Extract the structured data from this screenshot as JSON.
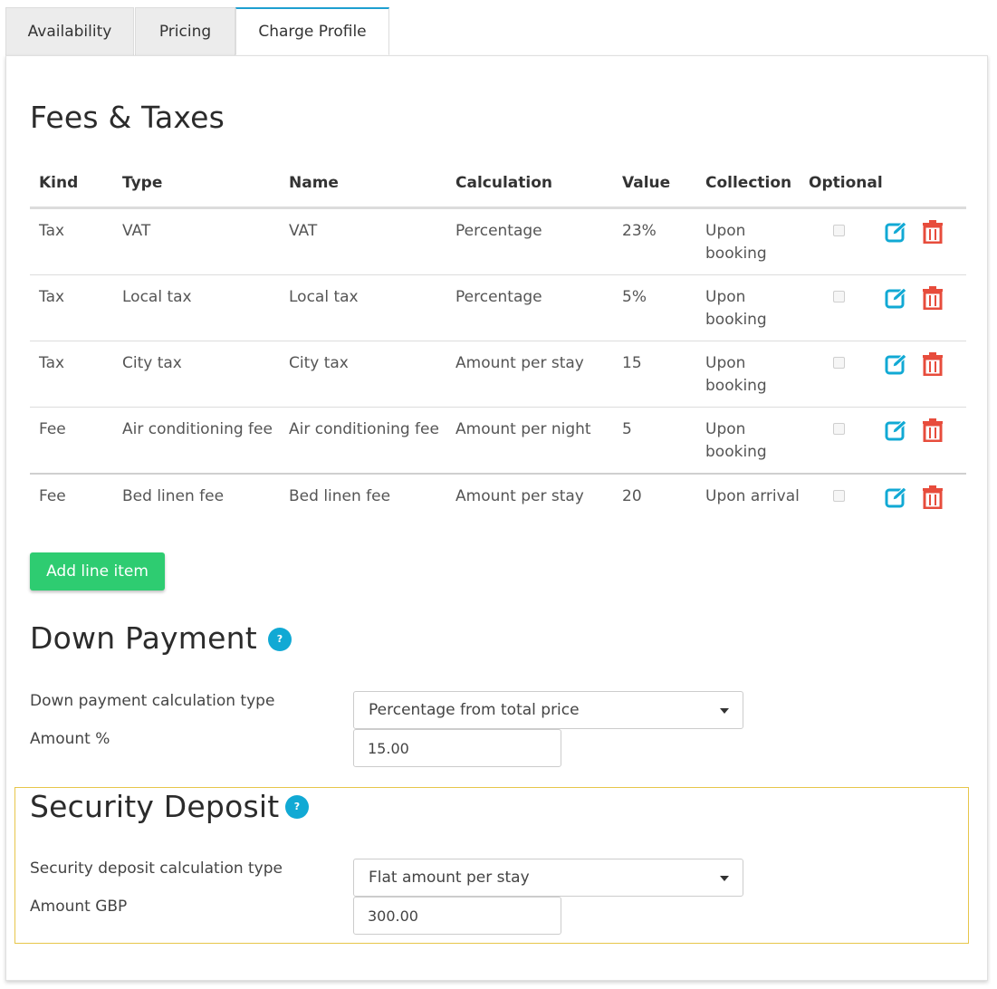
{
  "tabs": [
    {
      "label": "Availability",
      "active": false
    },
    {
      "label": "Pricing",
      "active": false
    },
    {
      "label": "Charge Profile",
      "active": true
    }
  ],
  "fees_taxes": {
    "title": "Fees & Taxes",
    "columns": [
      "Kind",
      "Type",
      "Name",
      "Calculation",
      "Value",
      "Collection",
      "Optional"
    ],
    "rows": [
      {
        "kind": "Tax",
        "type": "VAT",
        "name": "VAT",
        "calculation": "Percentage",
        "value": "23%",
        "collection": "Upon booking",
        "optional": false
      },
      {
        "kind": "Tax",
        "type": "Local tax",
        "name": "Local tax",
        "calculation": "Percentage",
        "value": "5%",
        "collection": "Upon booking",
        "optional": false
      },
      {
        "kind": "Tax",
        "type": "City tax",
        "name": "City tax",
        "calculation": "Amount per stay",
        "value": "15",
        "collection": "Upon booking",
        "optional": false
      },
      {
        "kind": "Fee",
        "type": "Air conditioning fee",
        "name": "Air conditioning fee",
        "calculation": "Amount per night",
        "value": "5",
        "collection": "Upon booking",
        "optional": false
      },
      {
        "kind": "Fee",
        "type": "Bed linen fee",
        "name": "Bed linen fee",
        "calculation": "Amount per stay",
        "value": "20",
        "collection": "Upon arrival",
        "optional": false
      }
    ],
    "add_button": "Add line item"
  },
  "down_payment": {
    "title": "Down Payment",
    "help": "?",
    "calc_type_label": "Down payment calculation type",
    "calc_type_value": "Percentage from total price",
    "amount_label": "Amount %",
    "amount_value": "15.00"
  },
  "security_deposit": {
    "title": "Security Deposit",
    "help": "?",
    "calc_type_label": "Security deposit calculation type",
    "calc_type_value": "Flat amount per stay",
    "amount_label": "Amount GBP",
    "amount_value": "300.00"
  },
  "colors": {
    "accent": "#1e9fd0",
    "edit_icon": "#11a9d4",
    "delete_icon": "#e74c3c",
    "add_button": "#2ecc71",
    "deposit_border": "#e7c64a"
  },
  "icons": {
    "edit": "edit-icon",
    "delete": "trash-icon",
    "help": "help-icon",
    "caret": "caret-down-icon"
  }
}
